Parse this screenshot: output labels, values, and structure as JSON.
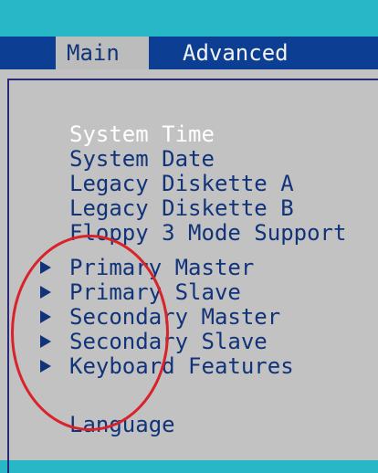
{
  "menubar": {
    "tabs": [
      {
        "label": "Main",
        "active": true
      },
      {
        "label": "Advanced",
        "active": false
      }
    ]
  },
  "items": [
    {
      "label": "System Time",
      "selected": true,
      "submenu": false
    },
    {
      "label": "System Date",
      "selected": false,
      "submenu": false
    },
    {
      "label": "Legacy Diskette A",
      "selected": false,
      "submenu": false
    },
    {
      "label": "Legacy Diskette B",
      "selected": false,
      "submenu": false
    },
    {
      "label": "Floppy 3 Mode Support",
      "selected": false,
      "submenu": false
    },
    {
      "label": "Primary Master",
      "selected": false,
      "submenu": true
    },
    {
      "label": "Primary Slave",
      "selected": false,
      "submenu": true
    },
    {
      "label": "Secondary Master",
      "selected": false,
      "submenu": true
    },
    {
      "label": "Secondary Slave",
      "selected": false,
      "submenu": true
    },
    {
      "label": "Keyboard Features",
      "selected": false,
      "submenu": true
    },
    {
      "label": "Language",
      "selected": false,
      "submenu": false
    }
  ],
  "colors": {
    "background": "#27b7c7",
    "menubar": "#0c3e93",
    "panel": "#c2c2c2",
    "text": "#10337a",
    "selected_text": "#ffffff",
    "highlight_circle": "#d8232a"
  },
  "icons": {
    "submenu": "triangle-right-icon"
  }
}
